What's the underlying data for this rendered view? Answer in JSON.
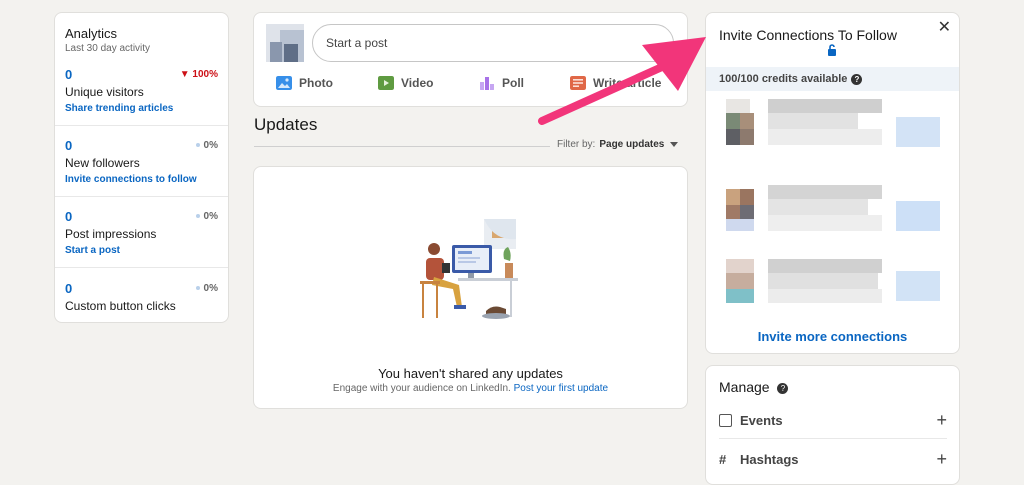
{
  "analytics": {
    "title": "Analytics",
    "subtitle": "Last 30 day activity",
    "metrics": [
      {
        "value": "0",
        "label": "Unique visitors",
        "change": "100%",
        "change_dir": "down",
        "link": "Share trending articles"
      },
      {
        "value": "0",
        "label": "New followers",
        "change": "0%",
        "change_dir": "flat",
        "link": "Invite connections to follow"
      },
      {
        "value": "0",
        "label": "Post impressions",
        "change": "0%",
        "change_dir": "flat",
        "link": "Start a post"
      },
      {
        "value": "0",
        "label": "Custom button clicks",
        "change": "0%",
        "change_dir": "flat",
        "link": ""
      }
    ]
  },
  "composer": {
    "placeholder": "Start a post",
    "actions": [
      {
        "label": "Photo",
        "icon": "photo-icon",
        "color": "#378fe9"
      },
      {
        "label": "Video",
        "icon": "video-icon",
        "color": "#5f9b41"
      },
      {
        "label": "Poll",
        "icon": "poll-icon",
        "color": "#a872e8"
      },
      {
        "label": "Write article",
        "icon": "article-icon",
        "color": "#e06847"
      }
    ]
  },
  "updates": {
    "title": "Updates",
    "filter_label": "Filter by:",
    "filter_value": "Page updates"
  },
  "empty_state": {
    "title": "You haven't shared any updates",
    "subtitle": "Engage with your audience on LinkedIn.",
    "link": "Post your first update"
  },
  "invite": {
    "title": "Invite Connections To Follow",
    "credits": "100/100 credits available",
    "more_link": "Invite more connections"
  },
  "manage": {
    "title": "Manage",
    "items": [
      {
        "label": "Events",
        "icon": "calendar-icon"
      },
      {
        "label": "Hashtags",
        "icon": "hashtag-icon"
      }
    ]
  },
  "colors": {
    "accent": "#0a66c2",
    "annotation_arrow": "#f2357a",
    "negative": "#cc1016"
  }
}
